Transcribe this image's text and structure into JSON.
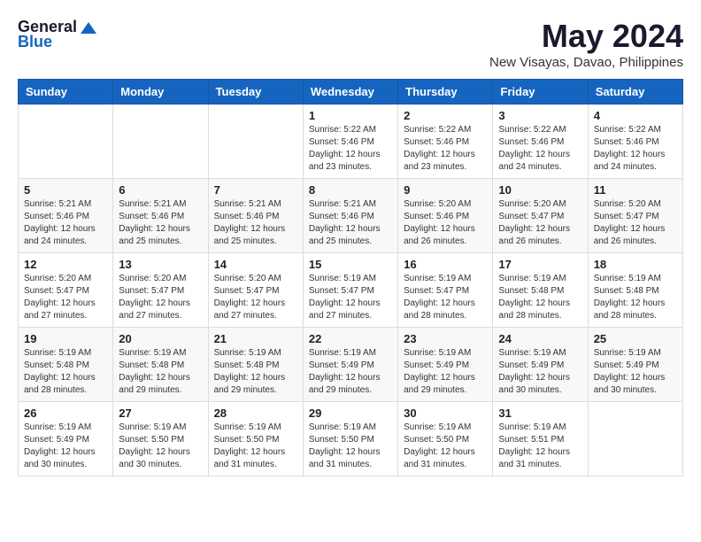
{
  "logo": {
    "general": "General",
    "blue": "Blue"
  },
  "title": "May 2024",
  "location": "New Visayas, Davao, Philippines",
  "days_of_week": [
    "Sunday",
    "Monday",
    "Tuesday",
    "Wednesday",
    "Thursday",
    "Friday",
    "Saturday"
  ],
  "weeks": [
    [
      {
        "day": "",
        "sunrise": "",
        "sunset": "",
        "daylight": ""
      },
      {
        "day": "",
        "sunrise": "",
        "sunset": "",
        "daylight": ""
      },
      {
        "day": "",
        "sunrise": "",
        "sunset": "",
        "daylight": ""
      },
      {
        "day": "1",
        "sunrise": "Sunrise: 5:22 AM",
        "sunset": "Sunset: 5:46 PM",
        "daylight": "Daylight: 12 hours and 23 minutes."
      },
      {
        "day": "2",
        "sunrise": "Sunrise: 5:22 AM",
        "sunset": "Sunset: 5:46 PM",
        "daylight": "Daylight: 12 hours and 23 minutes."
      },
      {
        "day": "3",
        "sunrise": "Sunrise: 5:22 AM",
        "sunset": "Sunset: 5:46 PM",
        "daylight": "Daylight: 12 hours and 24 minutes."
      },
      {
        "day": "4",
        "sunrise": "Sunrise: 5:22 AM",
        "sunset": "Sunset: 5:46 PM",
        "daylight": "Daylight: 12 hours and 24 minutes."
      }
    ],
    [
      {
        "day": "5",
        "sunrise": "Sunrise: 5:21 AM",
        "sunset": "Sunset: 5:46 PM",
        "daylight": "Daylight: 12 hours and 24 minutes."
      },
      {
        "day": "6",
        "sunrise": "Sunrise: 5:21 AM",
        "sunset": "Sunset: 5:46 PM",
        "daylight": "Daylight: 12 hours and 25 minutes."
      },
      {
        "day": "7",
        "sunrise": "Sunrise: 5:21 AM",
        "sunset": "Sunset: 5:46 PM",
        "daylight": "Daylight: 12 hours and 25 minutes."
      },
      {
        "day": "8",
        "sunrise": "Sunrise: 5:21 AM",
        "sunset": "Sunset: 5:46 PM",
        "daylight": "Daylight: 12 hours and 25 minutes."
      },
      {
        "day": "9",
        "sunrise": "Sunrise: 5:20 AM",
        "sunset": "Sunset: 5:46 PM",
        "daylight": "Daylight: 12 hours and 26 minutes."
      },
      {
        "day": "10",
        "sunrise": "Sunrise: 5:20 AM",
        "sunset": "Sunset: 5:47 PM",
        "daylight": "Daylight: 12 hours and 26 minutes."
      },
      {
        "day": "11",
        "sunrise": "Sunrise: 5:20 AM",
        "sunset": "Sunset: 5:47 PM",
        "daylight": "Daylight: 12 hours and 26 minutes."
      }
    ],
    [
      {
        "day": "12",
        "sunrise": "Sunrise: 5:20 AM",
        "sunset": "Sunset: 5:47 PM",
        "daylight": "Daylight: 12 hours and 27 minutes."
      },
      {
        "day": "13",
        "sunrise": "Sunrise: 5:20 AM",
        "sunset": "Sunset: 5:47 PM",
        "daylight": "Daylight: 12 hours and 27 minutes."
      },
      {
        "day": "14",
        "sunrise": "Sunrise: 5:20 AM",
        "sunset": "Sunset: 5:47 PM",
        "daylight": "Daylight: 12 hours and 27 minutes."
      },
      {
        "day": "15",
        "sunrise": "Sunrise: 5:19 AM",
        "sunset": "Sunset: 5:47 PM",
        "daylight": "Daylight: 12 hours and 27 minutes."
      },
      {
        "day": "16",
        "sunrise": "Sunrise: 5:19 AM",
        "sunset": "Sunset: 5:47 PM",
        "daylight": "Daylight: 12 hours and 28 minutes."
      },
      {
        "day": "17",
        "sunrise": "Sunrise: 5:19 AM",
        "sunset": "Sunset: 5:48 PM",
        "daylight": "Daylight: 12 hours and 28 minutes."
      },
      {
        "day": "18",
        "sunrise": "Sunrise: 5:19 AM",
        "sunset": "Sunset: 5:48 PM",
        "daylight": "Daylight: 12 hours and 28 minutes."
      }
    ],
    [
      {
        "day": "19",
        "sunrise": "Sunrise: 5:19 AM",
        "sunset": "Sunset: 5:48 PM",
        "daylight": "Daylight: 12 hours and 28 minutes."
      },
      {
        "day": "20",
        "sunrise": "Sunrise: 5:19 AM",
        "sunset": "Sunset: 5:48 PM",
        "daylight": "Daylight: 12 hours and 29 minutes."
      },
      {
        "day": "21",
        "sunrise": "Sunrise: 5:19 AM",
        "sunset": "Sunset: 5:48 PM",
        "daylight": "Daylight: 12 hours and 29 minutes."
      },
      {
        "day": "22",
        "sunrise": "Sunrise: 5:19 AM",
        "sunset": "Sunset: 5:49 PM",
        "daylight": "Daylight: 12 hours and 29 minutes."
      },
      {
        "day": "23",
        "sunrise": "Sunrise: 5:19 AM",
        "sunset": "Sunset: 5:49 PM",
        "daylight": "Daylight: 12 hours and 29 minutes."
      },
      {
        "day": "24",
        "sunrise": "Sunrise: 5:19 AM",
        "sunset": "Sunset: 5:49 PM",
        "daylight": "Daylight: 12 hours and 30 minutes."
      },
      {
        "day": "25",
        "sunrise": "Sunrise: 5:19 AM",
        "sunset": "Sunset: 5:49 PM",
        "daylight": "Daylight: 12 hours and 30 minutes."
      }
    ],
    [
      {
        "day": "26",
        "sunrise": "Sunrise: 5:19 AM",
        "sunset": "Sunset: 5:49 PM",
        "daylight": "Daylight: 12 hours and 30 minutes."
      },
      {
        "day": "27",
        "sunrise": "Sunrise: 5:19 AM",
        "sunset": "Sunset: 5:50 PM",
        "daylight": "Daylight: 12 hours and 30 minutes."
      },
      {
        "day": "28",
        "sunrise": "Sunrise: 5:19 AM",
        "sunset": "Sunset: 5:50 PM",
        "daylight": "Daylight: 12 hours and 31 minutes."
      },
      {
        "day": "29",
        "sunrise": "Sunrise: 5:19 AM",
        "sunset": "Sunset: 5:50 PM",
        "daylight": "Daylight: 12 hours and 31 minutes."
      },
      {
        "day": "30",
        "sunrise": "Sunrise: 5:19 AM",
        "sunset": "Sunset: 5:50 PM",
        "daylight": "Daylight: 12 hours and 31 minutes."
      },
      {
        "day": "31",
        "sunrise": "Sunrise: 5:19 AM",
        "sunset": "Sunset: 5:51 PM",
        "daylight": "Daylight: 12 hours and 31 minutes."
      },
      {
        "day": "",
        "sunrise": "",
        "sunset": "",
        "daylight": ""
      }
    ]
  ]
}
